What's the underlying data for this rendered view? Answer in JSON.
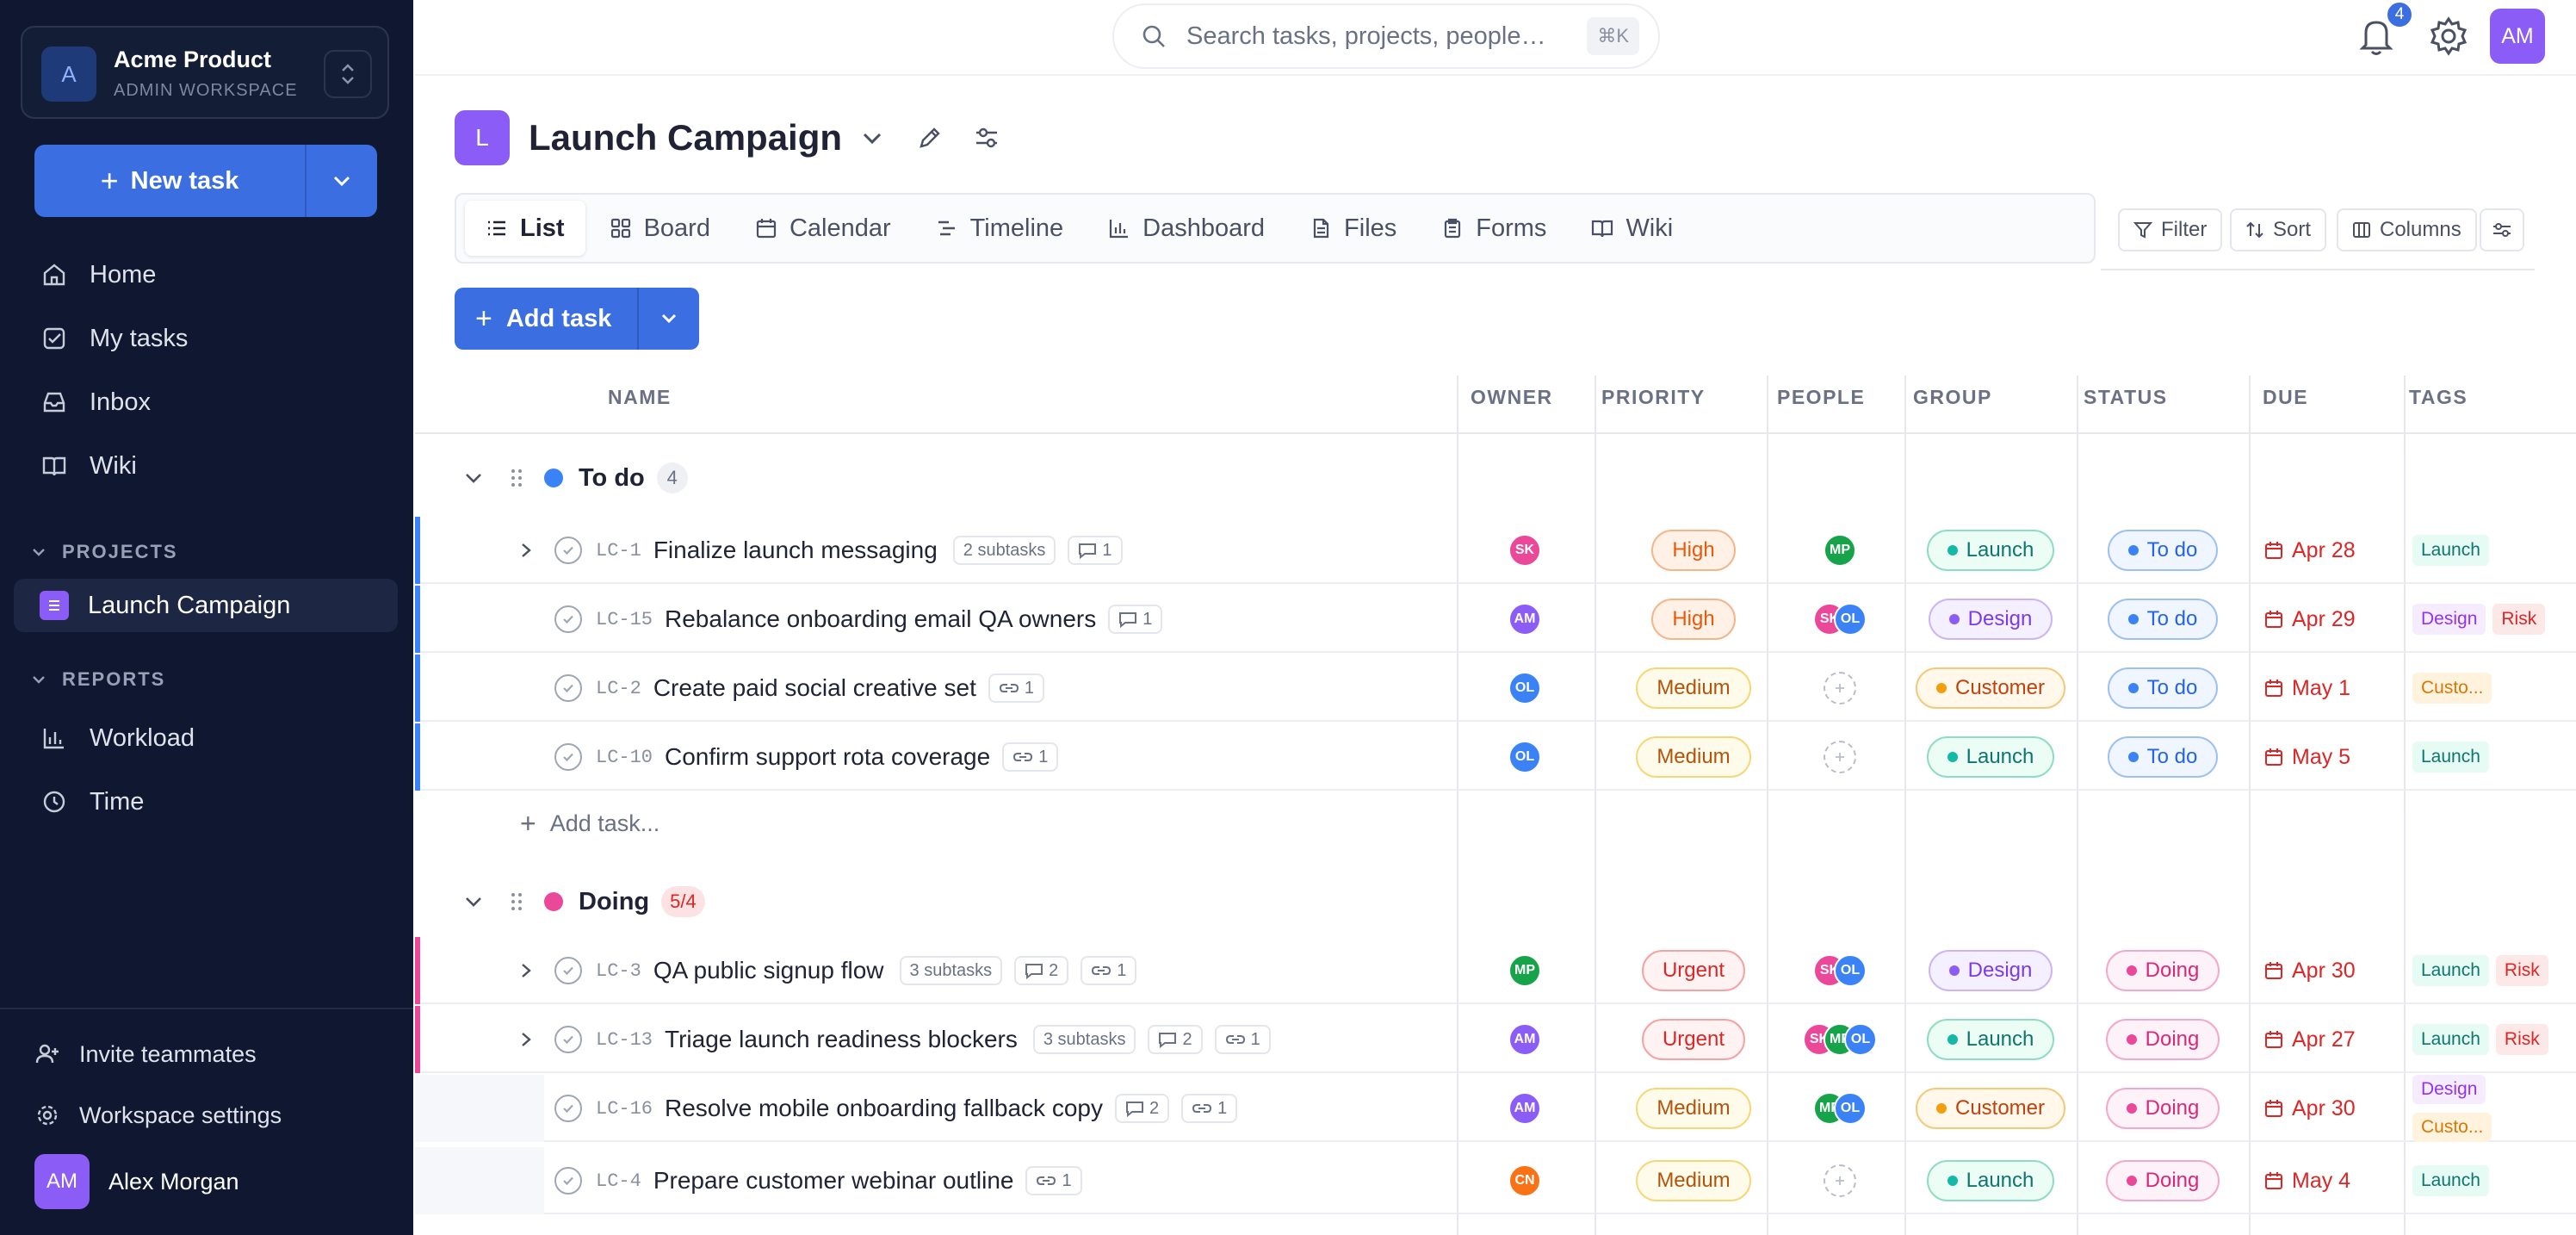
{
  "workspace": {
    "avatar": "A",
    "name": "Acme Product",
    "subtitle": "ADMIN WORKSPACE"
  },
  "new_task": {
    "label": "New task"
  },
  "nav": [
    {
      "label": "Home",
      "icon": "home-icon"
    },
    {
      "label": "My tasks",
      "icon": "check-square-icon"
    },
    {
      "label": "Inbox",
      "icon": "inbox-icon"
    },
    {
      "label": "Wiki",
      "icon": "book-icon"
    }
  ],
  "sections": {
    "projects": "PROJECTS",
    "reports": "REPORTS"
  },
  "project": {
    "label": "Launch Campaign"
  },
  "reports": [
    {
      "label": "Workload",
      "icon": "bar-chart-icon"
    },
    {
      "label": "Time",
      "icon": "clock-icon"
    }
  ],
  "footer": {
    "invite": "Invite teammates",
    "settings": "Workspace settings",
    "user_initials": "AM",
    "user_name": "Alex Morgan"
  },
  "topbar": {
    "search_placeholder": "Search tasks, projects, people…",
    "shortcut": "⌘K",
    "notifications": "4",
    "avatar": "AM"
  },
  "page": {
    "icon_letter": "L",
    "title": "Launch Campaign"
  },
  "tabs": [
    "List",
    "Board",
    "Calendar",
    "Timeline",
    "Dashboard",
    "Files",
    "Forms",
    "Wiki"
  ],
  "toolbar": {
    "filter": "Filter",
    "sort": "Sort",
    "columns": "Columns"
  },
  "add_task": {
    "label": "Add task"
  },
  "columns": {
    "name": "NAME",
    "owner": "OWNER",
    "priority": "PRIORITY",
    "people": "PEOPLE",
    "group": "GROUP",
    "status": "STATUS",
    "due": "DUE",
    "tags": "TAGS"
  },
  "groups": {
    "todo": {
      "label": "To do",
      "count": "4",
      "add": "Add task..."
    },
    "doing": {
      "label": "Doing",
      "count": "5/4"
    }
  },
  "colors": {
    "accent": "#3b6ee0",
    "todo": "#3b82f6",
    "doing": "#ec4899",
    "purple": "#8b5cf6"
  },
  "rows": [
    {
      "code": "LC-1",
      "name": "Finalize launch messaging",
      "subtasks": "2 subtasks",
      "comments": "1",
      "links": "",
      "owner": "SK",
      "priority": "High",
      "people": [
        "MP"
      ],
      "group": "Launch",
      "status": "To do",
      "due": "Apr 28",
      "tags": [
        "Launch"
      ]
    },
    {
      "code": "LC-15",
      "name": "Rebalance onboarding email QA owners",
      "subtasks": "",
      "comments": "1",
      "links": "",
      "owner": "AM",
      "priority": "High",
      "people": [
        "SK",
        "OL"
      ],
      "group": "Design",
      "status": "To do",
      "due": "Apr 29",
      "tags": [
        "Design",
        "Risk"
      ]
    },
    {
      "code": "LC-2",
      "name": "Create paid social creative set",
      "subtasks": "",
      "comments": "",
      "links": "1",
      "owner": "OL",
      "priority": "Medium",
      "people": [],
      "group": "Customer",
      "status": "To do",
      "due": "May 1",
      "tags": [
        "Custo..."
      ]
    },
    {
      "code": "LC-10",
      "name": "Confirm support rota coverage",
      "subtasks": "",
      "comments": "",
      "links": "1",
      "owner": "OL",
      "priority": "Medium",
      "people": [],
      "group": "Launch",
      "status": "To do",
      "due": "May 5",
      "tags": [
        "Launch"
      ]
    },
    {
      "code": "LC-3",
      "name": "QA public signup flow",
      "subtasks": "3 subtasks",
      "comments": "2",
      "links": "1",
      "owner": "MP",
      "priority": "Urgent",
      "people": [
        "SK",
        "OL"
      ],
      "group": "Design",
      "status": "Doing",
      "due": "Apr 30",
      "tags": [
        "Launch",
        "Risk"
      ]
    },
    {
      "code": "LC-13",
      "name": "Triage launch readiness blockers",
      "subtasks": "3 subtasks",
      "comments": "2",
      "links": "1",
      "owner": "AM",
      "priority": "Urgent",
      "people": [
        "SK",
        "MP",
        "OL"
      ],
      "group": "Launch",
      "status": "Doing",
      "due": "Apr 27",
      "tags": [
        "Launch",
        "Risk"
      ]
    },
    {
      "code": "LC-16",
      "name": "Resolve mobile onboarding fallback copy",
      "subtasks": "",
      "comments": "2",
      "links": "1",
      "owner": "AM",
      "priority": "Medium",
      "people": [
        "MP",
        "OL"
      ],
      "group": "Customer",
      "status": "Doing",
      "due": "Apr 30",
      "tags": [
        "Design",
        "Custo..."
      ]
    },
    {
      "code": "LC-4",
      "name": "Prepare customer webinar outline",
      "subtasks": "",
      "comments": "",
      "links": "1",
      "owner": "CN",
      "priority": "Medium",
      "people": [],
      "group": "Launch",
      "status": "Doing",
      "due": "May 4",
      "tags": [
        "Launch"
      ]
    }
  ]
}
